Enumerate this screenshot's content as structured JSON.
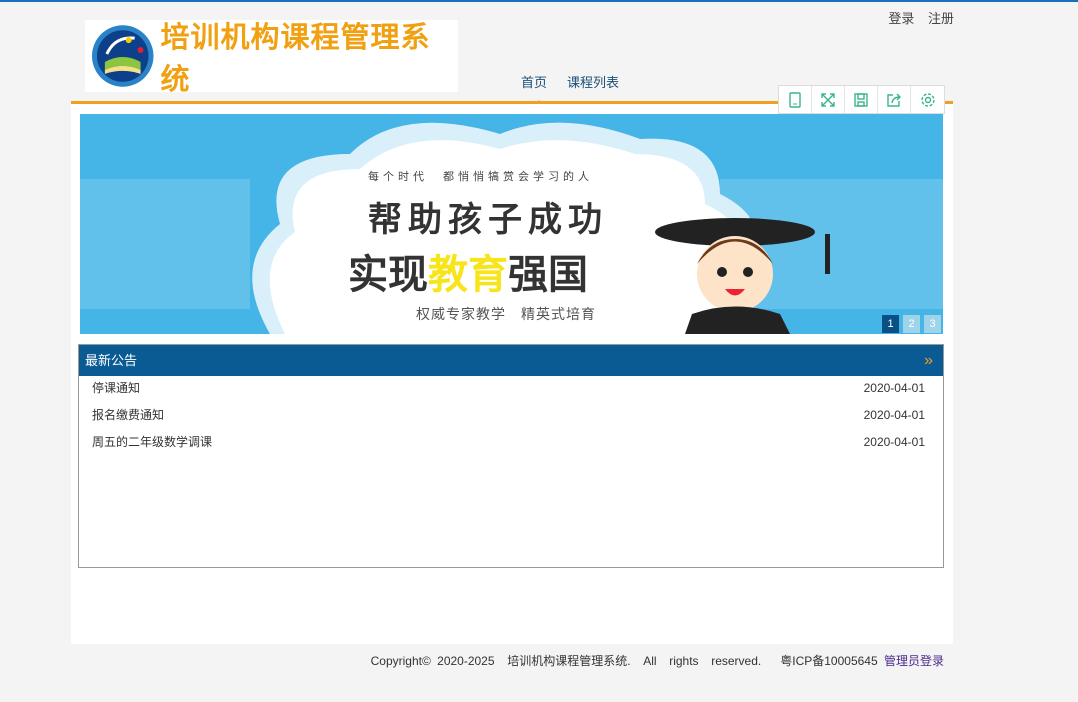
{
  "auth": {
    "login": "登录",
    "register": "注册"
  },
  "logo": {
    "title": "培训机构课程管理系统"
  },
  "nav": [
    {
      "label": "首页"
    },
    {
      "label": "课程列表"
    }
  ],
  "toolbar": [
    "tablet-icon",
    "fullscreen-icon",
    "save-icon",
    "share-icon",
    "settings-icon"
  ],
  "banner": {
    "tagline": "每个时代　都悄悄犒赏会学习的人",
    "line1": "帮助孩子成功",
    "line2a": "实现",
    "line2b": "教育",
    "line2c": "强国",
    "sub": "权威专家教学　精英式培育",
    "pages": [
      "1",
      "2",
      "3"
    ],
    "active_page": 1
  },
  "notice": {
    "title": "最新公告",
    "more": "»",
    "items": [
      {
        "title": "停课通知",
        "date": "2020-04-01"
      },
      {
        "title": "报名缴费通知",
        "date": "2020-04-01"
      },
      {
        "title": "周五的二年级数学调课",
        "date": "2020-04-01"
      }
    ]
  },
  "footer": {
    "text": "Copyright© 2020-2025  培训机构课程管理系统.  All  rights  reserved.   粤ICP备10005645",
    "admin": "管理员登录"
  },
  "colors": {
    "accent": "#f0a020",
    "header": "#0a5b94",
    "top": "#1a6fbf"
  }
}
